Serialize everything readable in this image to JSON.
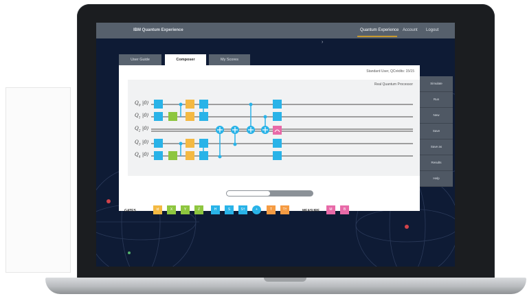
{
  "app": {
    "title": "IBM Quantum Experience"
  },
  "nav": {
    "items": [
      "Quantum Experience",
      "Account",
      "Logout"
    ],
    "active": "Quantum Experience"
  },
  "tabs": [
    {
      "label": "User Guide"
    },
    {
      "label": "Composer"
    },
    {
      "label": "My Scores"
    }
  ],
  "active_tab": "Composer",
  "composer": {
    "user_info": "Standard User, QCrédits: 15/15",
    "backend": "Real Quantum Processor",
    "qubits": [
      {
        "name": "Q",
        "index": "0",
        "state": "|0⟩"
      },
      {
        "name": "Q",
        "index": "1",
        "state": "|0⟩"
      },
      {
        "name": "Q",
        "index": "2",
        "state": "|0⟩"
      },
      {
        "name": "Q",
        "index": "3",
        "state": "|0⟩"
      },
      {
        "name": "Q",
        "index": "4",
        "state": "|0⟩"
      }
    ],
    "scroll_position": 0.5
  },
  "palette": {
    "gates_label": "GATES",
    "measure_label": "MEASURE",
    "gates": [
      {
        "label": "id",
        "color": "#f4b942"
      },
      {
        "label": "X",
        "color": "#8ec63f"
      },
      {
        "label": "Y",
        "color": "#8ec63f"
      },
      {
        "label": "Z",
        "color": "#8ec63f"
      },
      {
        "label": "H",
        "color": "#29b3e8"
      },
      {
        "label": "S",
        "color": "#29b3e8"
      },
      {
        "label": "S†",
        "color": "#29b3e8"
      },
      {
        "label": "+",
        "color": "#29b3e8"
      },
      {
        "label": "T",
        "color": "#f59b42"
      },
      {
        "label": "T†",
        "color": "#f59b42"
      }
    ],
    "measure": [
      {
        "label": "M",
        "color": "#e86aa8"
      },
      {
        "label": "B",
        "color": "#e86aa8"
      }
    ]
  },
  "actions": [
    "Simulate",
    "Run",
    "New",
    "Save",
    "Save as",
    "Results",
    "Help"
  ]
}
